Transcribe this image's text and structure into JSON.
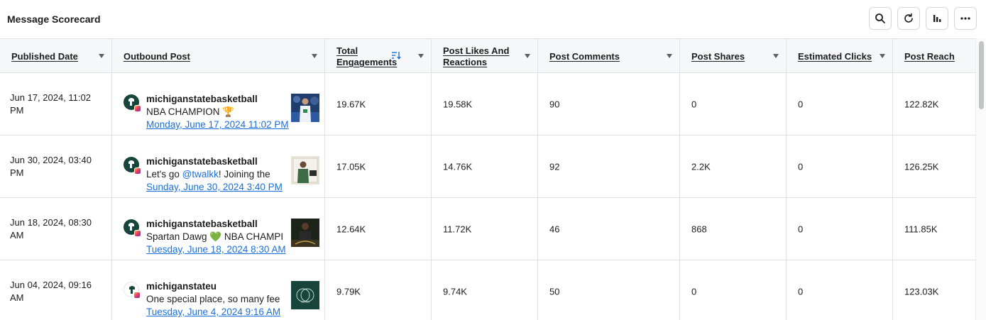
{
  "header": {
    "title": "Message Scorecard",
    "tools": [
      {
        "icon": "search-icon"
      },
      {
        "icon": "refresh-icon"
      },
      {
        "icon": "bar-chart-icon"
      },
      {
        "icon": "more-icon"
      }
    ]
  },
  "table": {
    "columns": [
      {
        "label": "Published Date"
      },
      {
        "label": "Outbound Post"
      },
      {
        "label": "Total Engagements",
        "sorted": true
      },
      {
        "label": "Post Likes And Reactions"
      },
      {
        "label": "Post Comments"
      },
      {
        "label": "Post Shares"
      },
      {
        "label": "Estimated Clicks"
      },
      {
        "label": "Post Reach"
      }
    ],
    "rows": [
      {
        "date": "Jun 17, 2024, 11:02 PM",
        "account": "michiganstatebasketball",
        "text_before": "NBA CHAMPION 🏆",
        "mention": "",
        "text_after": "",
        "link": "Monday, June 17, 2024 11:02 PM",
        "engagements": "19.67K",
        "likes": "19.58K",
        "comments": "90",
        "shares": "0",
        "clicks": "0",
        "reach": "122.82K"
      },
      {
        "date": "Jun 30, 2024, 03:40 PM",
        "account": "michiganstatebasketball",
        "text_before": "Let's go ",
        "mention": "@twalkk",
        "text_after": "! Joining the",
        "link": "Sunday, June 30, 2024 3:40 PM",
        "engagements": "17.05K",
        "likes": "14.76K",
        "comments": "92",
        "shares": "2.2K",
        "clicks": "0",
        "reach": "126.25K"
      },
      {
        "date": "Jun 18, 2024, 08:30 AM",
        "account": "michiganstatebasketball",
        "text_before": "Spartan Dawg 💚 NBA CHAMPI",
        "mention": "",
        "text_after": "",
        "link": "Tuesday, June 18, 2024 8:30 AM",
        "engagements": "12.64K",
        "likes": "11.72K",
        "comments": "46",
        "shares": "868",
        "clicks": "0",
        "reach": "111.85K"
      },
      {
        "date": "Jun 04, 2024, 09:16 AM",
        "account": "michiganstateu",
        "text_before": "One special place, so many fee",
        "mention": "",
        "text_after": "",
        "link": "Tuesday, June 4, 2024 9:16 AM",
        "engagements": "9.79K",
        "likes": "9.74K",
        "comments": "50",
        "shares": "0",
        "clicks": "0",
        "reach": "123.03K"
      }
    ]
  },
  "colors": {
    "link": "#1b6fd8",
    "header_bg": "#f6f7f8",
    "border": "#dfe1e5",
    "spartan_green": "#18453b"
  }
}
